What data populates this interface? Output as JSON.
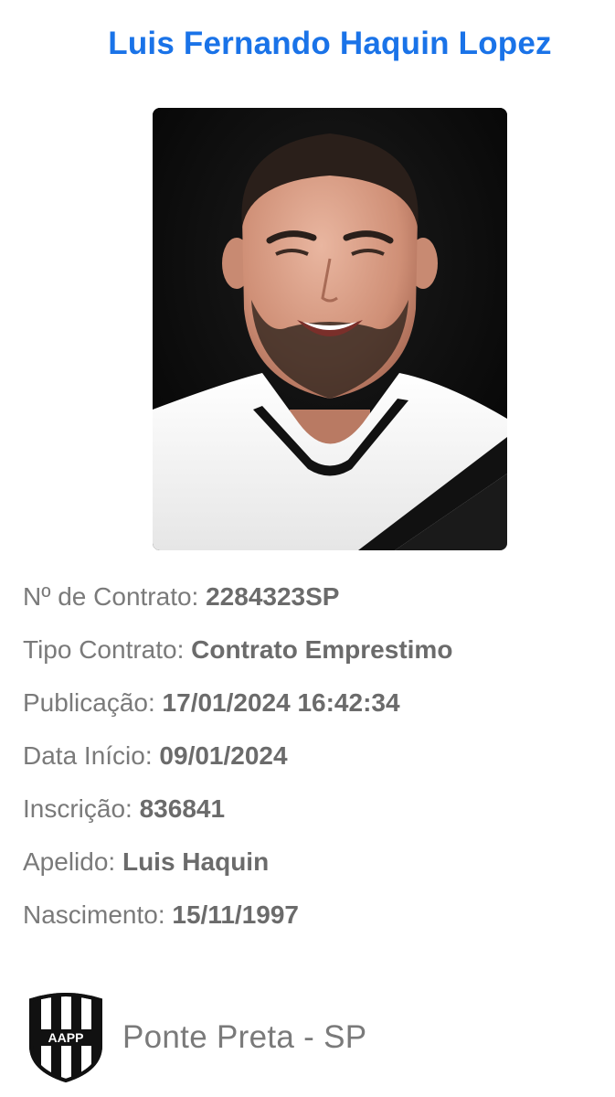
{
  "header": {
    "player_name": "Luis Fernando Haquin Lopez"
  },
  "photo": {
    "icon": "player-portrait"
  },
  "details": [
    {
      "label": "Nº de Contrato:",
      "value": "2284323SP"
    },
    {
      "label": "Tipo Contrato:",
      "value": "Contrato Emprestimo"
    },
    {
      "label": "Publicação:",
      "value": "17/01/2024 16:42:34"
    },
    {
      "label": "Data Início:",
      "value": "09/01/2024"
    },
    {
      "label": "Inscrição:",
      "value": "836841"
    },
    {
      "label": "Apelido:",
      "value": "Luis Haquin"
    },
    {
      "label": "Nascimento:",
      "value": "15/11/1997"
    }
  ],
  "club": {
    "logo_text": "AAPP",
    "name": "Ponte Preta - SP"
  },
  "colors": {
    "title": "#1a73e8",
    "label": "#7a7a7a",
    "value": "#6b6b6b"
  }
}
